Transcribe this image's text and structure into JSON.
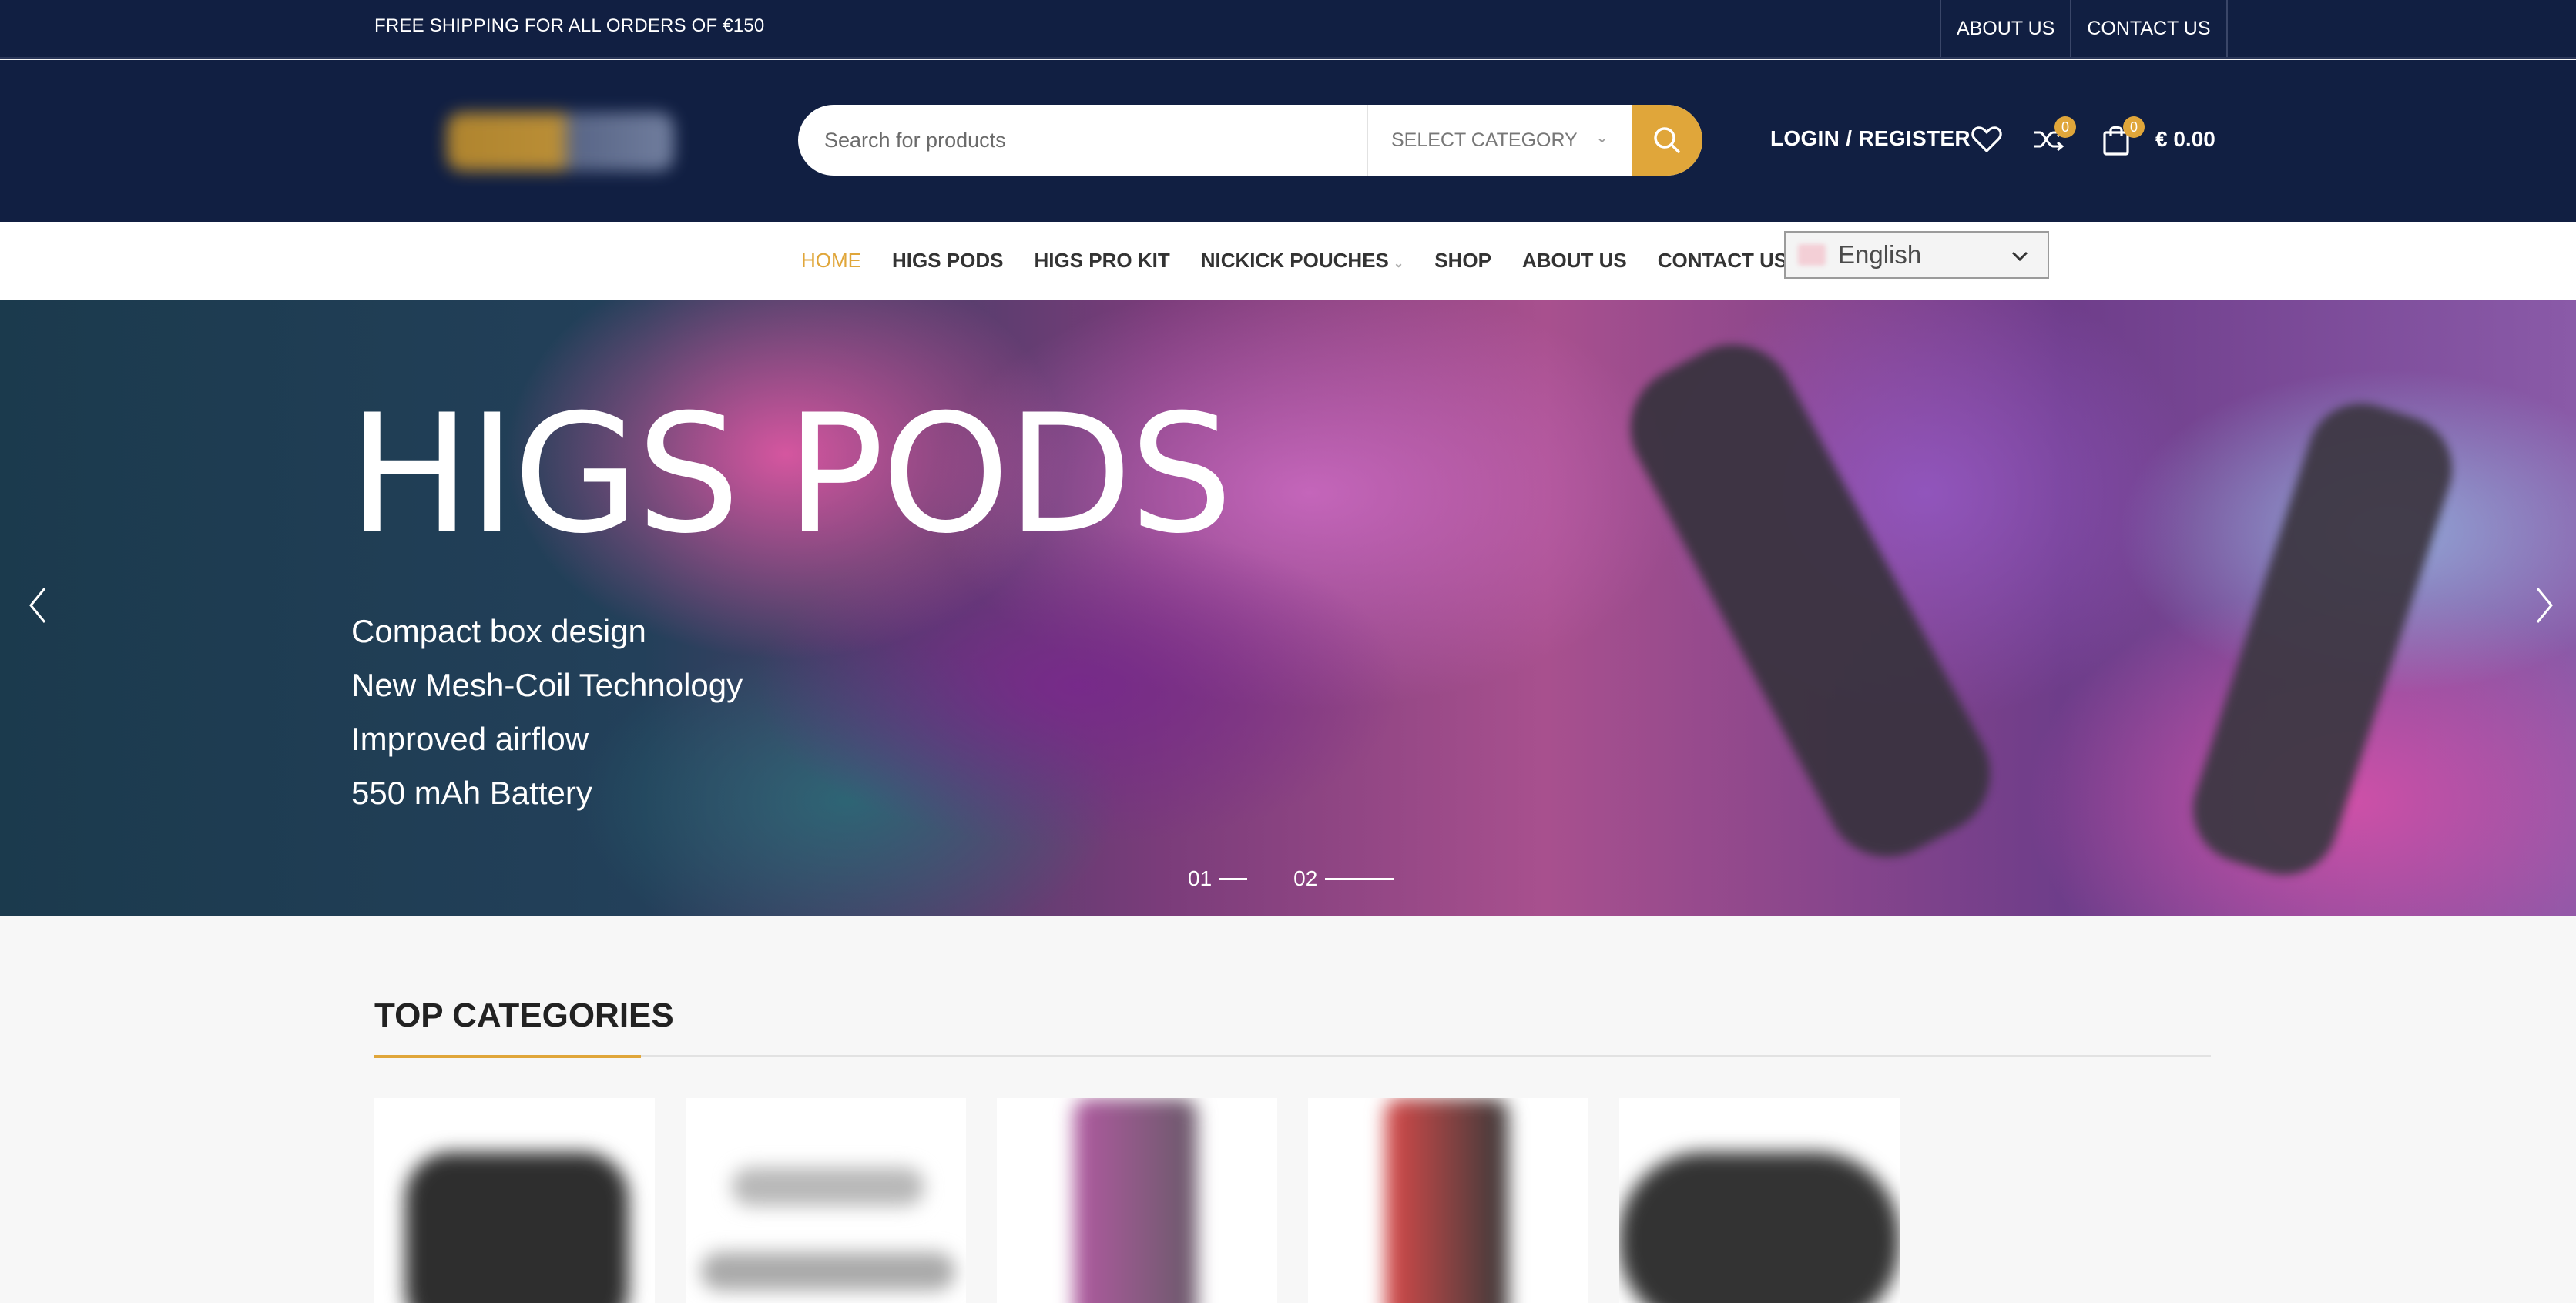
{
  "topbar": {
    "shipping": "FREE SHIPPING FOR ALL ORDERS OF €150",
    "links": [
      "ABOUT US",
      "CONTACT US"
    ]
  },
  "header": {
    "search_placeholder": "Search for products",
    "category_select": "SELECT CATEGORY",
    "account": "LOGIN / REGISTER",
    "compare_count": "0",
    "cart_count": "0",
    "cart_total": "€ 0.00"
  },
  "nav": {
    "items": [
      "HOME",
      "HIGS PODS",
      "HIGS PRO KIT",
      "NICKICK POUCHES",
      "SHOP",
      "ABOUT US",
      "CONTACT US"
    ],
    "language": "English"
  },
  "hero": {
    "title": "HIGS PODS",
    "features": [
      "Compact box design",
      "New Mesh-Coil Technology",
      "Improved airflow",
      "550 mAh Battery"
    ],
    "slides": [
      "01",
      "02"
    ]
  },
  "categories": {
    "title": "TOP CATEGORIES"
  },
  "colors": {
    "navy": "#111f42",
    "accent": "#e0a63a"
  }
}
